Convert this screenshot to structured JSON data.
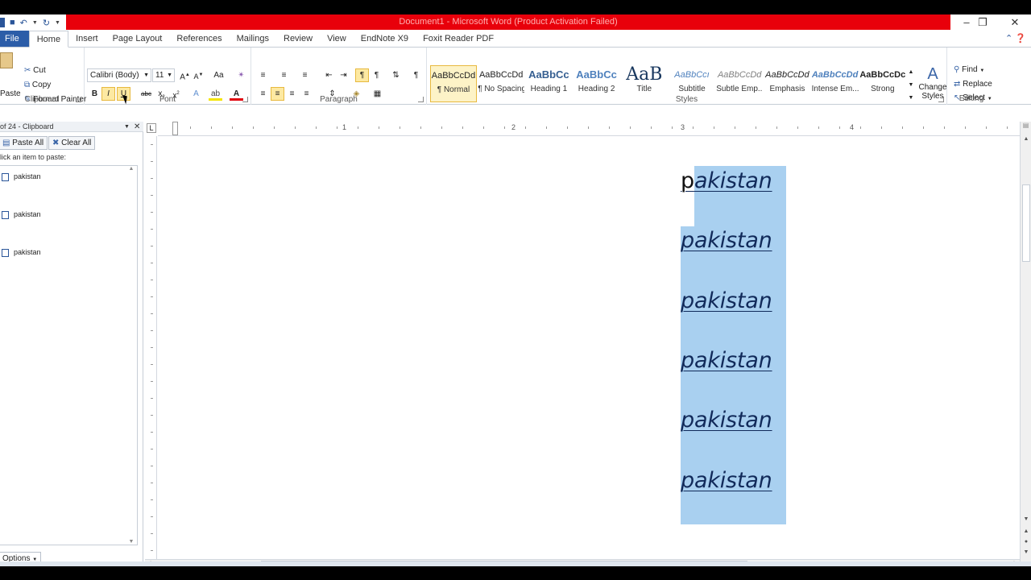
{
  "window": {
    "title": "Document1  -  Microsoft Word (Product Activation Failed)"
  },
  "tabs": [
    "File",
    "Home",
    "Insert",
    "Page Layout",
    "References",
    "Mailings",
    "Review",
    "View",
    "EndNote X9",
    "Foxit Reader PDF"
  ],
  "ribbon": {
    "clipboard": {
      "label": "Clipboard",
      "paste": "Paste",
      "cut": "Cut",
      "copy": "Copy",
      "format_painter": "Format Painter"
    },
    "font": {
      "label": "Font",
      "family": "Calibri (Body)",
      "size": "11"
    },
    "paragraph": {
      "label": "Paragraph"
    },
    "styles": {
      "label": "Styles",
      "items": [
        {
          "preview": "AaBbCcDd",
          "name": "¶ Normal"
        },
        {
          "preview": "AaBbCcDd",
          "name": "¶ No Spacing"
        },
        {
          "preview": "AaBbCc",
          "name": "Heading 1"
        },
        {
          "preview": "AaBbCc",
          "name": "Heading 2"
        },
        {
          "preview": "AaB",
          "name": "Title"
        },
        {
          "preview": "AaBbCcı",
          "name": "Subtitle"
        },
        {
          "preview": "AaBbCcDd",
          "name": "Subtle Emp..."
        },
        {
          "preview": "AaBbCcDd",
          "name": "Emphasis"
        },
        {
          "preview": "AaBbCcDd",
          "name": "Intense Em..."
        },
        {
          "preview": "AaBbCcDc",
          "name": "Strong"
        }
      ],
      "change_styles": "Change Styles"
    },
    "editing": {
      "label": "Editing",
      "find": "Find",
      "replace": "Replace",
      "select": "Select"
    }
  },
  "clipboard_pane": {
    "header": "of 24 - Clipboard",
    "paste_all": "Paste All",
    "clear_all": "Clear All",
    "hint": "lick an item to paste:",
    "items": [
      "pakistan",
      "pakistan",
      "pakistan"
    ],
    "options": "Options"
  },
  "ruler": {
    "numbers": [
      "1",
      "2",
      "3",
      "4"
    ]
  },
  "document": {
    "lines": [
      "pakistan",
      "pakistan",
      "pakistan",
      "pakistan",
      "pakistan",
      "pakistan"
    ],
    "first_char": "p",
    "first_rest": "akistan"
  },
  "colors": {
    "title_bar": "#e8000b",
    "file_tab": "#2c5da8",
    "selection": "#a9d0f0",
    "highlight_button": "#fde9a2"
  }
}
